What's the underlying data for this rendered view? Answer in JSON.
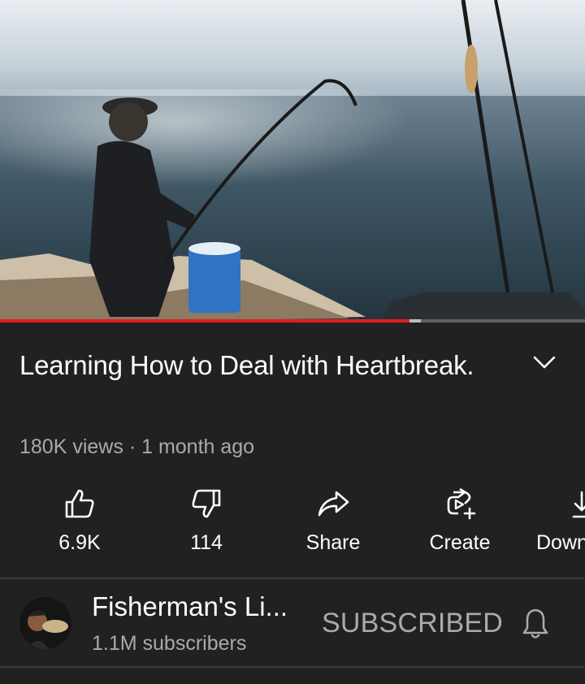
{
  "video": {
    "progress_played": 0.7,
    "progress_buffered": 0.72
  },
  "title": "Learning How to Deal with Heartbreak.",
  "meta": {
    "views": "180K views",
    "separator": "·",
    "age": "1 month ago"
  },
  "actions": [
    {
      "icon": "thumbs-up-icon",
      "label": "6.9K"
    },
    {
      "icon": "thumbs-down-icon",
      "label": "114"
    },
    {
      "icon": "share-icon",
      "label": "Share"
    },
    {
      "icon": "create-icon",
      "label": "Create"
    },
    {
      "icon": "download-icon",
      "label": "Down"
    }
  ],
  "channel": {
    "name": "Fisherman's Li...",
    "subscribers": "1.1M subscribers",
    "subscribe_label": "SUBSCRIBED"
  },
  "colors": {
    "background": "#212121",
    "progress_red": "#e0201b",
    "secondary_text": "#aaaaaa"
  }
}
